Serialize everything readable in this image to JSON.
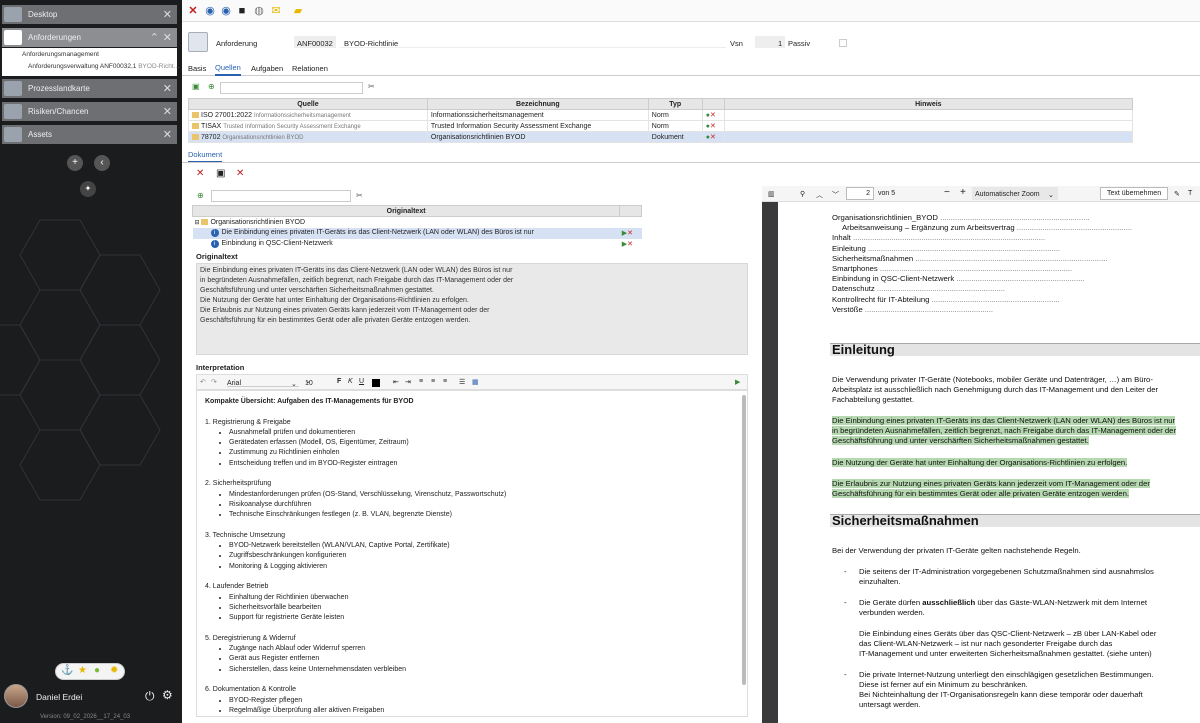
{
  "sidebar": {
    "items": [
      "Desktop",
      "Anforderungen",
      "Prozesslandkarte",
      "Risiken/Chancen",
      "Assets"
    ],
    "sub": [
      "Anforderungsmanagement",
      "Anforderungsverwaltung ANF00032,1",
      "BYOD-Richt..."
    ],
    "user": "Daniel Erdei",
    "version": "Version: 09_02_2026__17_24_03"
  },
  "header": {
    "label": "Anforderung",
    "id": "ANF00032",
    "title": "BYOD-Richtlinie",
    "vsn_label": "Vsn",
    "vsn": "1",
    "passiv": "Passiv"
  },
  "tabs": [
    "Basis",
    "Quellen",
    "Aufgaben",
    "Relationen"
  ],
  "quellen": {
    "columns": [
      "Quelle",
      "Bezeichnung",
      "Typ",
      "Hinweis"
    ],
    "rows": [
      {
        "code": "ISO 27001:2022",
        "sub": "Informationssicherheitsmanagement",
        "bez": "Informationssicherheitsmanagement",
        "typ": "Norm"
      },
      {
        "code": "TISAX",
        "sub": "Trusted Information Security Assessment Exchange",
        "bez": "Trusted Information Security Assessment Exchange",
        "typ": "Norm"
      },
      {
        "code": "78702",
        "sub": "Organisationsrichtlinien BYOD",
        "bez": "Organisationsrichtlinien BYOD",
        "typ": "Dokument"
      }
    ]
  },
  "doc_tab": "Dokument",
  "original": {
    "col": "Originaltext",
    "tree_root": "Organisationsrichtlinien BYOD",
    "tree": [
      "Die Einbindung eines privaten IT-Geräts ins das Client-Netzwerk (LAN oder WLAN) des Büros ist nur",
      "Einbindung in QSC-Client-Netzwerk"
    ],
    "section": "Originaltext",
    "text": [
      "Die Einbindung eines privaten IT-Geräts ins das Client-Netzwerk (LAN oder WLAN) des Büros ist nur",
      "in begründeten Ausnahmefällen, zeitlich begrenzt, nach Freigabe durch das IT-Management oder der",
      "Geschäftsführung und unter verschärften Sicherheitsmaßnahmen gestattet.",
      "Die Nutzung der Geräte hat unter Einhaltung der Organisations-Richtlinien zu erfolgen.",
      "Die Erlaubnis zur Nutzung eines privaten Geräts kann jederzeit vom IT-Management oder der",
      "Geschäftsführung für ein bestimmtes Gerät oder alle privaten Geräte entzogen werden."
    ]
  },
  "interpretation": {
    "section": "Interpretation",
    "font": "Arial",
    "size": "10",
    "heading": "Kompakte Übersicht: Aufgaben des IT-Managements für BYOD",
    "groups": [
      {
        "t": "1. Registrierung & Freigabe",
        "items": [
          "Ausnahmefall prüfen und dokumentieren",
          "Gerätedaten erfassen (Modell, OS, Eigentümer, Zeitraum)",
          "Zustimmung zu Richtlinien einholen",
          "Entscheidung treffen und im BYOD-Register eintragen"
        ]
      },
      {
        "t": "2. Sicherheitsprüfung",
        "items": [
          "Mindestanforderungen prüfen (OS-Stand, Verschlüsselung, Virenschutz, Passwortschutz)",
          "Risikoanalyse durchführen",
          "Technische Einschränkungen festlegen (z. B. VLAN, begrenzte Dienste)"
        ]
      },
      {
        "t": "3. Technische Umsetzung",
        "items": [
          "BYOD-Netzwerk bereitstellen (WLAN/VLAN, Captive Portal, Zertifikate)",
          "Zugriffsbeschränkungen konfigurieren",
          "Monitoring & Logging aktivieren"
        ]
      },
      {
        "t": "4. Laufender Betrieb",
        "items": [
          "Einhaltung der Richtlinien überwachen",
          "Sicherheitsvorfälle bearbeiten",
          "Support für registrierte Geräte leisten"
        ]
      },
      {
        "t": "5. Deregistrierung & Widerruf",
        "items": [
          "Zugänge nach Ablauf oder Widerruf sperren",
          "Gerät aus Register entfernen",
          "Sicherstellen, dass keine Unternehmensdaten verbleiben"
        ]
      },
      {
        "t": "6. Dokumentation & Kontrolle",
        "items": [
          "BYOD-Register pflegen",
          "Regelmäßige Überprüfung aller aktiven Freigaben"
        ]
      }
    ]
  },
  "pdf": {
    "page": "2",
    "of": "von 5",
    "zoom": "Automatischer Zoom",
    "apply": "Text übernehmen",
    "toc": [
      "Organisationsrichtlinien_BYOD",
      "Arbeitsanweisung – Ergänzung zum Arbeitsvertrag",
      "Inhalt",
      "Einleitung",
      "Sicherheitsmaßnahmen",
      "Smartphones",
      "Einbindung in QSC-Client-Netzwerk",
      "Datenschutz",
      "Kontrollrecht für IT-Abteilung",
      "Verstöße"
    ],
    "h_einleitung": "Einleitung",
    "p1": [
      "Die Verwendung privater IT-Geräte (Notebooks, mobiler Geräte und Datenträger, …) am Büro-",
      "Arbeitsplatz ist ausschließlich nach Genehmigung durch das IT-Management und den Leiter der",
      "Fachabteilung gestattet."
    ],
    "hl1": [
      "Die Einbindung eines privaten IT-Geräts ins das Client-Netzwerk (LAN oder WLAN) des Büros ist nur",
      "in begründeten Ausnahmefällen, zeitlich begrenzt, nach Freigabe durch das IT-Management oder der",
      "Geschäftsführung und unter verschärften Sicherheitsmaßnahmen gestattet."
    ],
    "hl2": "Die Nutzung der Geräte hat unter Einhaltung der Organisations-Richtlinien zu erfolgen.",
    "hl3": [
      "Die Erlaubnis zur Nutzung eines privaten Geräts kann jederzeit vom IT-Management oder der",
      "Geschäftsführung für ein bestimmtes Gerät oder alle privaten Geräte entzogen werden."
    ],
    "h_sicher": "Sicherheitsmaßnahmen",
    "p2": "Bei der Verwendung der privaten IT-Geräte gelten nachstehende Regeln.",
    "b1": [
      "Die seitens der IT-Administration vorgegebenen Schutzmaßnahmen sind ausnahmslos",
      "einzuhalten."
    ],
    "b2a": "Die Geräte dürfen ",
    "b2b": "ausschließlich",
    "b2c": " über das Gäste-WLAN-Netzwerk mit dem Internet",
    "b2d": "verbunden werden.",
    "b2e": [
      "Die Einbindung eines Geräts über das QSC-Client-Netzwerk – zB über LAN-Kabel oder",
      "das Client-WLAN-Netzwerk – ist nur nach gesonderter Freigabe durch das",
      "IT-Management und unter erweiterten Sicherheitsmaßnahmen gestattet. (siehe unten)"
    ],
    "b3": [
      "Die private Internet-Nutzung unterliegt den einschlägigen gesetzlichen Bestimmungen.",
      "Diese ist ferner auf ein Minimum zu beschränken.",
      "Bei Nichteinhaltung der IT-Organisationsregeln kann diese temporär oder dauerhaft",
      "untersagt werden."
    ]
  }
}
